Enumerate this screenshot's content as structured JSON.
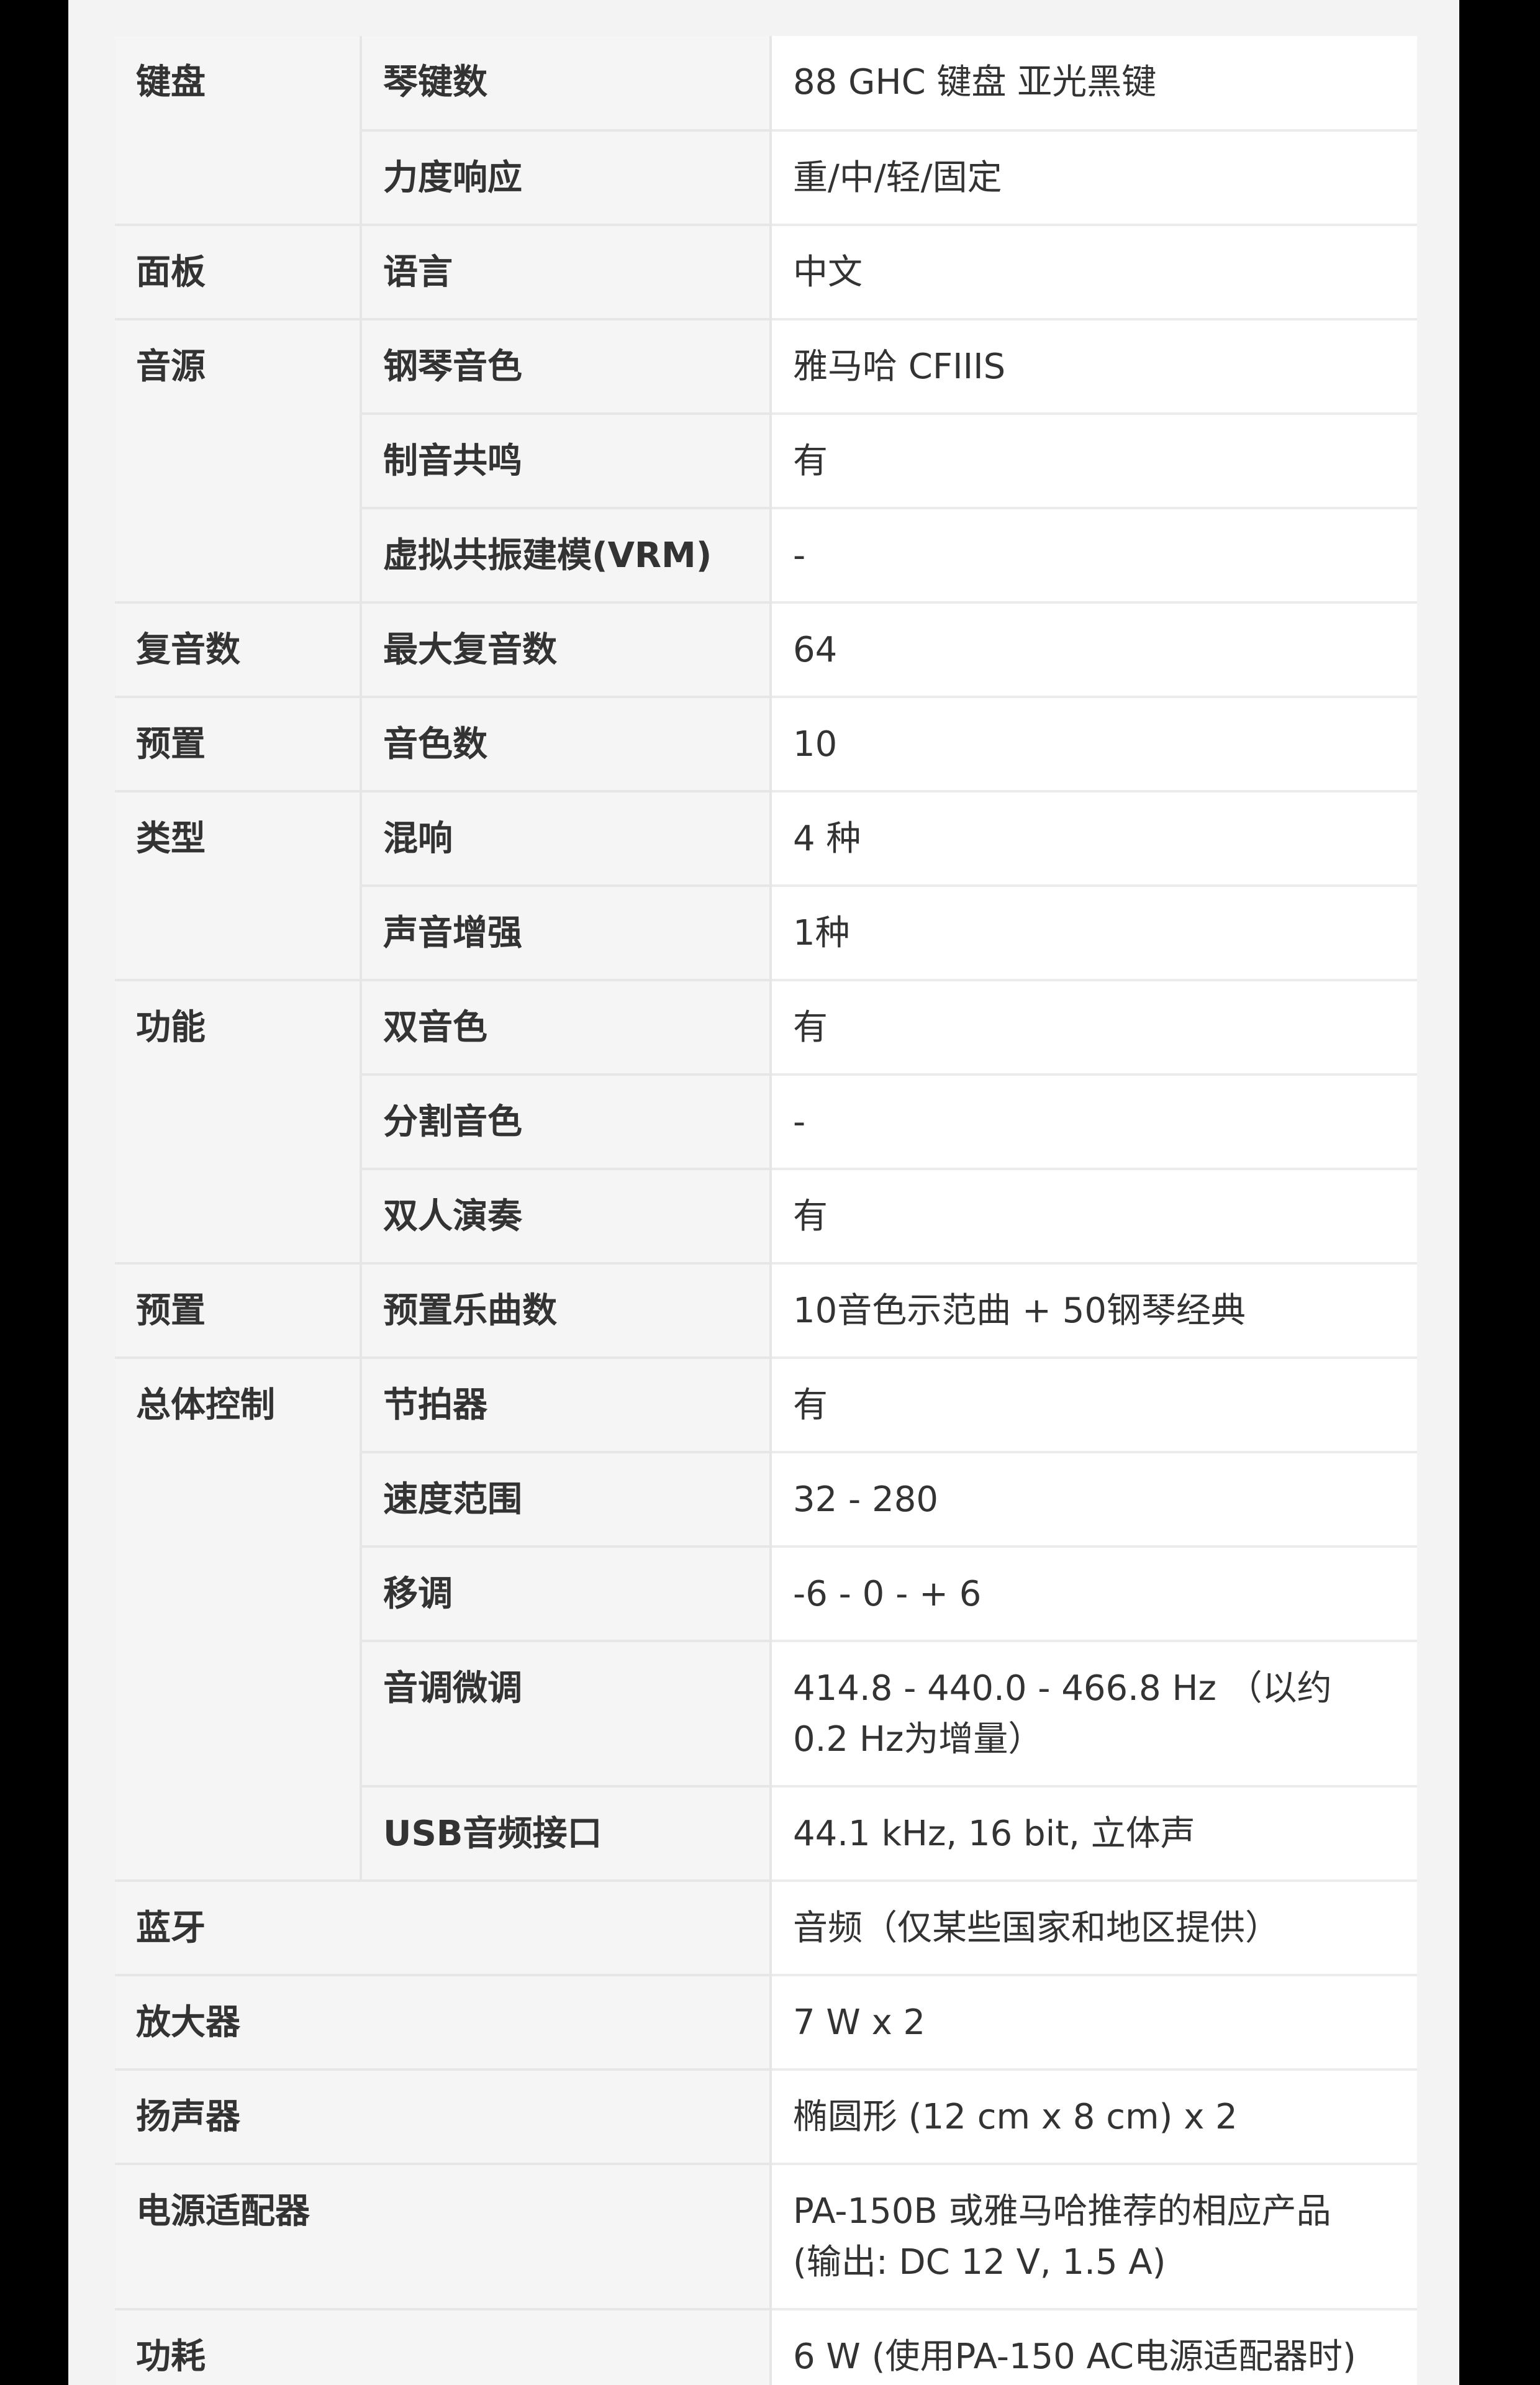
{
  "specs": {
    "keyboard": {
      "category": "键盘",
      "keys_label": "琴键数",
      "keys_value": "88 GHC 键盘 亚光黑键",
      "touch_label": "力度响应",
      "touch_value": "重/中/轻/固定"
    },
    "panel": {
      "category": "面板",
      "language_label": "语言",
      "language_value": "中文"
    },
    "tone": {
      "category": "音源",
      "piano_label": "钢琴音色",
      "piano_value": "雅马哈 CFIIIS",
      "damper_label": "制音共鸣",
      "damper_value": "有",
      "vrm_label": "虚拟共振建模(VRM)",
      "vrm_value": "-"
    },
    "polyphony": {
      "category": "复音数",
      "max_label": "最大复音数",
      "max_value": "64"
    },
    "preset_voices": {
      "category": "预置",
      "count_label": "音色数",
      "count_value": "10"
    },
    "type": {
      "category": "类型",
      "reverb_label": "混响",
      "reverb_value": "4 种",
      "enhancer_label": "声音增强",
      "enhancer_value": "1种"
    },
    "functions": {
      "category": "功能",
      "dual_label": "双音色",
      "dual_value": "有",
      "split_label": "分割音色",
      "split_value": "-",
      "duo_label": "双人演奏",
      "duo_value": "有"
    },
    "preset_songs": {
      "category": "预置",
      "songs_label": "预置乐曲数",
      "songs_value": "10音色示范曲 + 50钢琴经典"
    },
    "overall": {
      "category": "总体控制",
      "metronome_label": "节拍器",
      "metronome_value": "有",
      "tempo_label": "速度范围",
      "tempo_value": "32 - 280",
      "transpose_label": "移调",
      "transpose_value": "-6 - 0 - + 6",
      "tuning_label": "音调微调",
      "tuning_value": "414.8 - 440.0 - 466.8 Hz （以约0.2 Hz为增量）",
      "usb_label": "USB音频接口",
      "usb_value": "44.1 kHz, 16 bit, 立体声"
    },
    "bluetooth": {
      "label": "蓝牙",
      "value": "音频（仅某些国家和地区提供）"
    },
    "amplifier": {
      "label": "放大器",
      "value": "7 W x 2"
    },
    "speakers": {
      "label": "扬声器",
      "value": "椭圆形 (12 cm x 8 cm) x 2"
    },
    "adaptor": {
      "label": "电源适配器",
      "value": "PA-150B 或雅马哈推荐的相应产品 (输出: DC 12 V, 1.5 A)"
    },
    "power": {
      "label": "功耗",
      "value": "6 W (使用PA-150 AC电源适配器时)"
    }
  }
}
